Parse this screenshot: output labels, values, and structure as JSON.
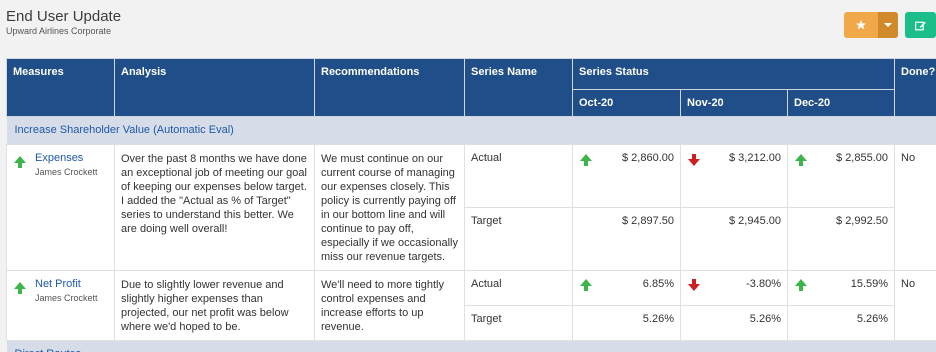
{
  "header": {
    "title": "End User Update",
    "subtitle": "Upward Airlines Corporate"
  },
  "toolbar": {
    "favorite_icon": "star-icon",
    "dropdown_icon": "caret-down-icon",
    "edit_icon": "edit-icon"
  },
  "colors": {
    "header_bg": "#1f4e88",
    "section_bg": "#d6dde9",
    "link": "#1f58a8",
    "arrow_up": "#3cb54a",
    "arrow_down": "#cc1f1f",
    "favorite": "#f0a849",
    "edit": "#1bbd8a"
  },
  "table": {
    "headers": {
      "measures": "Measures",
      "analysis": "Analysis",
      "recommendations": "Recommendations",
      "series_name": "Series Name",
      "series_status": "Series Status",
      "done": "Done?"
    },
    "months": [
      "Oct-20",
      "Nov-20",
      "Dec-20"
    ],
    "sections": [
      {
        "title": "Increase Shareholder Value (Automatic Eval)",
        "rows": [
          {
            "measure": "Expenses",
            "owner": "James Crockett",
            "trend": "up",
            "analysis": "Over the past 8 months we have done an exceptional job of meeting our goal of keeping our expenses below target. I added the \"Actual as % of Target\" series to understand this better. We are doing well overall!",
            "recommendation": "We must continue on our current course of managing our expenses closely.  This policy is currently paying off in our bottom line and will continue to pay off, especially if we occasionally miss our revenue targets.",
            "done": "No",
            "series": [
              {
                "name": "Actual",
                "values": [
                  "$ 2,860.00",
                  "$ 3,212.00",
                  "$ 2,855.00"
                ],
                "arrows": [
                  "up",
                  "down",
                  "up"
                ]
              },
              {
                "name": "Target",
                "values": [
                  "$ 2,897.50",
                  "$ 2,945.00",
                  "$ 2,992.50"
                ],
                "arrows": [
                  "",
                  "",
                  ""
                ]
              }
            ]
          },
          {
            "measure": "Net Profit",
            "owner": "James Crockett",
            "trend": "up",
            "analysis": "Due to slightly lower revenue and slightly higher expenses than projected, our net profit was below where we'd hoped to be.",
            "recommendation": "We'll need to more tightly control expenses and increase efforts to up revenue.",
            "done": "No",
            "series": [
              {
                "name": "Actual",
                "values": [
                  "6.85%",
                  "-3.80%",
                  "15.59%"
                ],
                "arrows": [
                  "up",
                  "down",
                  "up"
                ]
              },
              {
                "name": "Target",
                "values": [
                  "5.26%",
                  "5.26%",
                  "5.26%"
                ],
                "arrows": [
                  "",
                  "",
                  ""
                ]
              }
            ]
          }
        ]
      },
      {
        "title": "Direct Routes",
        "rows": []
      }
    ]
  }
}
